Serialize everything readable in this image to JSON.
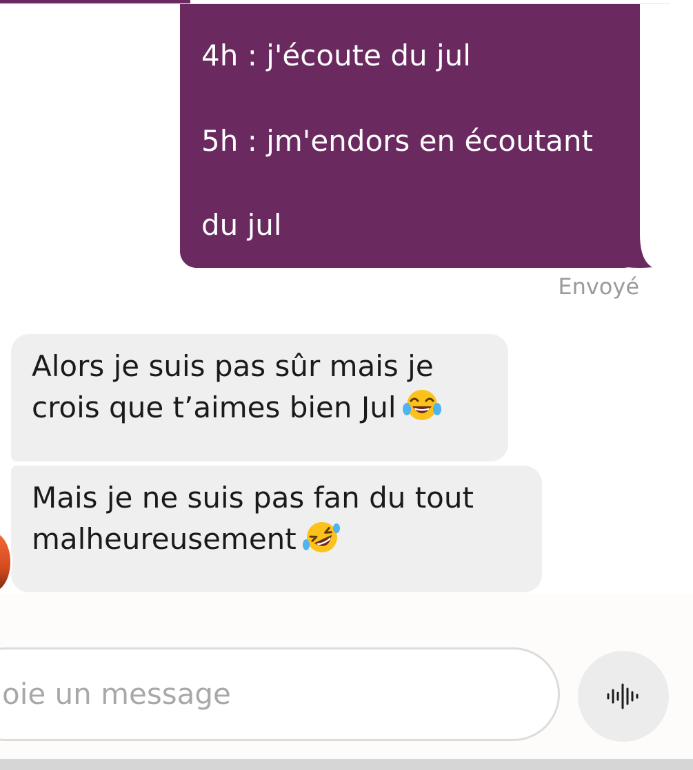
{
  "conversation": {
    "sent_message": {
      "lines": [
        "4h : j'écoute du jul",
        "5h : jm'endors en écoutant",
        "du jul"
      ],
      "status": "Envoyé",
      "bubble_color": "#6a295f"
    },
    "received_messages": [
      {
        "lines": [
          "Alors je suis pas sûr mais je",
          "crois que t’aimes bien Jul"
        ],
        "emoji": "face-with-tears-of-joy-icon"
      },
      {
        "lines": [
          "Mais je ne suis pas fan du tout",
          "malheureusement"
        ],
        "emoji": "rolling-on-the-floor-laughing-icon"
      }
    ],
    "received_bubble_color": "#efefef"
  },
  "composer": {
    "placeholder": "oie un message",
    "voice_icon": "voice-waveform-icon"
  }
}
